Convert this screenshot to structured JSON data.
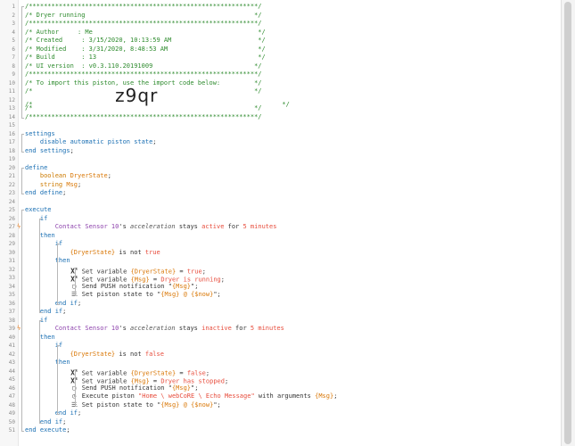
{
  "lines": [
    {
      "n": "1",
      "s": [
        [
          "c",
          "/*************************************************************/"
        ]
      ]
    },
    {
      "n": "2",
      "s": [
        [
          "c",
          "/* Dryer running                                             */"
        ]
      ]
    },
    {
      "n": "3",
      "s": [
        [
          "c",
          "/*************************************************************/"
        ]
      ]
    },
    {
      "n": "4",
      "s": [
        [
          "c",
          "/* Author     : Me                                            */"
        ]
      ]
    },
    {
      "n": "5",
      "s": [
        [
          "c",
          "/* Created     : 3/15/2020, 10:13:59 AM                       */"
        ]
      ]
    },
    {
      "n": "6",
      "s": [
        [
          "c",
          "/* Modified    : 3/31/2020, 8:48:53 AM                        */"
        ]
      ]
    },
    {
      "n": "7",
      "s": [
        [
          "c",
          "/* Build       : 13                                           */"
        ]
      ]
    },
    {
      "n": "8",
      "s": [
        [
          "c",
          "/* UI version  : v0.3.110.20191009                           */"
        ]
      ]
    },
    {
      "n": "9",
      "s": [
        [
          "c",
          "/*************************************************************/"
        ]
      ]
    },
    {
      "n": "10",
      "s": [
        [
          "c",
          "/* To import this piston, use the import code below:         */"
        ]
      ]
    },
    {
      "n": "11",
      "s": [
        [
          "c",
          "/*                                                           */"
        ]
      ]
    },
    {
      "n": "12",
      "s": [
        [
          "c",
          "/*                      "
        ],
        [
          "big",
          "z9qr"
        ],
        [
          "c",
          "                                 */"
        ]
      ]
    },
    {
      "n": "13",
      "s": [
        [
          "c",
          "/*                                                           */"
        ]
      ]
    },
    {
      "n": "14",
      "s": [
        [
          "c",
          "/*************************************************************/"
        ]
      ]
    },
    {
      "n": "15",
      "s": []
    },
    {
      "n": "16",
      "s": [
        [
          "k",
          "settings"
        ]
      ]
    },
    {
      "n": "17",
      "s": [
        [
          "p",
          "    "
        ],
        [
          "k",
          "disable automatic piston state"
        ],
        [
          "p",
          ";"
        ]
      ]
    },
    {
      "n": "18",
      "s": [
        [
          "k",
          "end settings"
        ],
        [
          "p",
          ";"
        ]
      ]
    },
    {
      "n": "19",
      "s": []
    },
    {
      "n": "20",
      "s": [
        [
          "k",
          "define"
        ]
      ]
    },
    {
      "n": "21",
      "s": [
        [
          "p",
          "    "
        ],
        [
          "t",
          "boolean"
        ],
        [
          "p",
          " "
        ],
        [
          "v",
          "DryerState"
        ],
        [
          "p",
          ";"
        ]
      ]
    },
    {
      "n": "22",
      "s": [
        [
          "p",
          "    "
        ],
        [
          "t",
          "string"
        ],
        [
          "p",
          " "
        ],
        [
          "v",
          "Msg"
        ],
        [
          "p",
          ";"
        ]
      ]
    },
    {
      "n": "23",
      "s": [
        [
          "k",
          "end define"
        ],
        [
          "p",
          ";"
        ]
      ]
    },
    {
      "n": "24",
      "s": []
    },
    {
      "n": "25",
      "s": [
        [
          "k",
          "execute"
        ]
      ]
    },
    {
      "n": "26",
      "s": [
        [
          "p",
          "    "
        ],
        [
          "k",
          "if"
        ]
      ]
    },
    {
      "n": "27",
      "m": "ϟ",
      "s": [
        [
          "p",
          "        "
        ],
        [
          "d",
          "Contact Sensor 10"
        ],
        [
          "p",
          "'s "
        ],
        [
          "a",
          "acceleration"
        ],
        [
          "p",
          " stays "
        ],
        [
          "s",
          "active"
        ],
        [
          "p",
          " for "
        ],
        [
          "n",
          "5 minutes"
        ]
      ]
    },
    {
      "n": "28",
      "s": [
        [
          "p",
          "    "
        ],
        [
          "k",
          "then"
        ]
      ]
    },
    {
      "n": "29",
      "s": [
        [
          "p",
          "        "
        ],
        [
          "k",
          "if"
        ]
      ]
    },
    {
      "n": "30",
      "s": [
        [
          "p",
          "            "
        ],
        [
          "v",
          "{DryerState}"
        ],
        [
          "p",
          " is not "
        ],
        [
          "s",
          "true"
        ]
      ]
    },
    {
      "n": "31",
      "s": [
        [
          "p",
          "        "
        ],
        [
          "k",
          "then"
        ]
      ]
    },
    {
      "n": "32",
      "s": [
        [
          "p",
          "            "
        ],
        [
          "ix",
          "x"
        ],
        [
          "p",
          " Set variable "
        ],
        [
          "v",
          "{DryerState}"
        ],
        [
          "p",
          " = "
        ],
        [
          "s",
          "true"
        ],
        [
          "p",
          ";"
        ]
      ]
    },
    {
      "n": "33",
      "s": [
        [
          "p",
          "            "
        ],
        [
          "ix",
          "x"
        ],
        [
          "p",
          " Set variable "
        ],
        [
          "v",
          "{Msg}"
        ],
        [
          "p",
          " = "
        ],
        [
          "s",
          "Dryer is running"
        ],
        [
          "p",
          ";"
        ]
      ]
    },
    {
      "n": "34",
      "s": [
        [
          "p",
          "            "
        ],
        [
          "ic",
          "msg"
        ],
        [
          "p",
          " Send PUSH notification \""
        ],
        [
          "v",
          "{Msg}"
        ],
        [
          "p",
          "\";"
        ]
      ]
    },
    {
      "n": "35",
      "s": [
        [
          "p",
          "            "
        ],
        [
          "ic",
          "list"
        ],
        [
          "p",
          " Set piston state to \""
        ],
        [
          "v",
          "{Msg} @ {$now}"
        ],
        [
          "p",
          "\";"
        ]
      ]
    },
    {
      "n": "36",
      "s": [
        [
          "p",
          "        "
        ],
        [
          "k",
          "end if"
        ],
        [
          "p",
          ";"
        ]
      ]
    },
    {
      "n": "37",
      "s": [
        [
          "p",
          "    "
        ],
        [
          "k",
          "end if"
        ],
        [
          "p",
          ";"
        ]
      ]
    },
    {
      "n": "38",
      "s": [
        [
          "p",
          "    "
        ],
        [
          "k",
          "if"
        ]
      ]
    },
    {
      "n": "39",
      "m": "ϟ",
      "s": [
        [
          "p",
          "        "
        ],
        [
          "d",
          "Contact Sensor 10"
        ],
        [
          "p",
          "'s "
        ],
        [
          "a",
          "acceleration"
        ],
        [
          "p",
          " stays "
        ],
        [
          "s",
          "inactive"
        ],
        [
          "p",
          " for "
        ],
        [
          "n",
          "5 minutes"
        ]
      ]
    },
    {
      "n": "40",
      "s": [
        [
          "p",
          "    "
        ],
        [
          "k",
          "then"
        ]
      ]
    },
    {
      "n": "41",
      "s": [
        [
          "p",
          "        "
        ],
        [
          "k",
          "if"
        ]
      ]
    },
    {
      "n": "42",
      "s": [
        [
          "p",
          "            "
        ],
        [
          "v",
          "{DryerState}"
        ],
        [
          "p",
          " is not "
        ],
        [
          "s",
          "false"
        ]
      ]
    },
    {
      "n": "43",
      "s": [
        [
          "p",
          "        "
        ],
        [
          "k",
          "then"
        ]
      ]
    },
    {
      "n": "44",
      "s": [
        [
          "p",
          "            "
        ],
        [
          "ix",
          "x"
        ],
        [
          "p",
          " Set variable "
        ],
        [
          "v",
          "{DryerState}"
        ],
        [
          "p",
          " = "
        ],
        [
          "s",
          "false"
        ],
        [
          "p",
          ";"
        ]
      ]
    },
    {
      "n": "45",
      "s": [
        [
          "p",
          "            "
        ],
        [
          "ix",
          "x"
        ],
        [
          "p",
          " Set variable "
        ],
        [
          "v",
          "{Msg}"
        ],
        [
          "p",
          " = "
        ],
        [
          "s",
          "Dryer has stopped"
        ],
        [
          "p",
          ";"
        ]
      ]
    },
    {
      "n": "46",
      "s": [
        [
          "p",
          "            "
        ],
        [
          "ic",
          "msg"
        ],
        [
          "p",
          " Send PUSH notification \""
        ],
        [
          "v",
          "{Msg}"
        ],
        [
          "p",
          "\";"
        ]
      ]
    },
    {
      "n": "47",
      "s": [
        [
          "p",
          "            "
        ],
        [
          "ic",
          "clock"
        ],
        [
          "p",
          " Execute piston "
        ],
        [
          "s",
          "\"Home \\ webCoRE \\ Echo Message\""
        ],
        [
          "p",
          " with arguments "
        ],
        [
          "v",
          "{Msg}"
        ],
        [
          "p",
          ";"
        ]
      ]
    },
    {
      "n": "48",
      "s": [
        [
          "p",
          "            "
        ],
        [
          "ic",
          "list"
        ],
        [
          "p",
          " Set piston state to \""
        ],
        [
          "v",
          "{Msg} @ {$now}"
        ],
        [
          "p",
          "\";"
        ]
      ]
    },
    {
      "n": "49",
      "s": [
        [
          "p",
          "        "
        ],
        [
          "k",
          "end if"
        ],
        [
          "p",
          ";"
        ]
      ]
    },
    {
      "n": "50",
      "s": [
        [
          "p",
          "    "
        ],
        [
          "k",
          "end if"
        ],
        [
          "p",
          ";"
        ]
      ]
    },
    {
      "n": "51",
      "s": [
        [
          "k",
          "end execute"
        ],
        [
          "p",
          ";"
        ]
      ]
    }
  ],
  "icons": {
    "x": "x-icon",
    "msg": "message-icon",
    "list": "list-icon",
    "clock": "clock-icon",
    "trigger": "lightning-trigger-icon"
  },
  "colors": {
    "comment": "#2e8b2e",
    "keyword": "#1a6fb3",
    "type": "#cc7a00",
    "variable": "#d97706",
    "device": "#8e44ad",
    "value": "#e74c3c",
    "trigger_marker": "#e67e22"
  }
}
